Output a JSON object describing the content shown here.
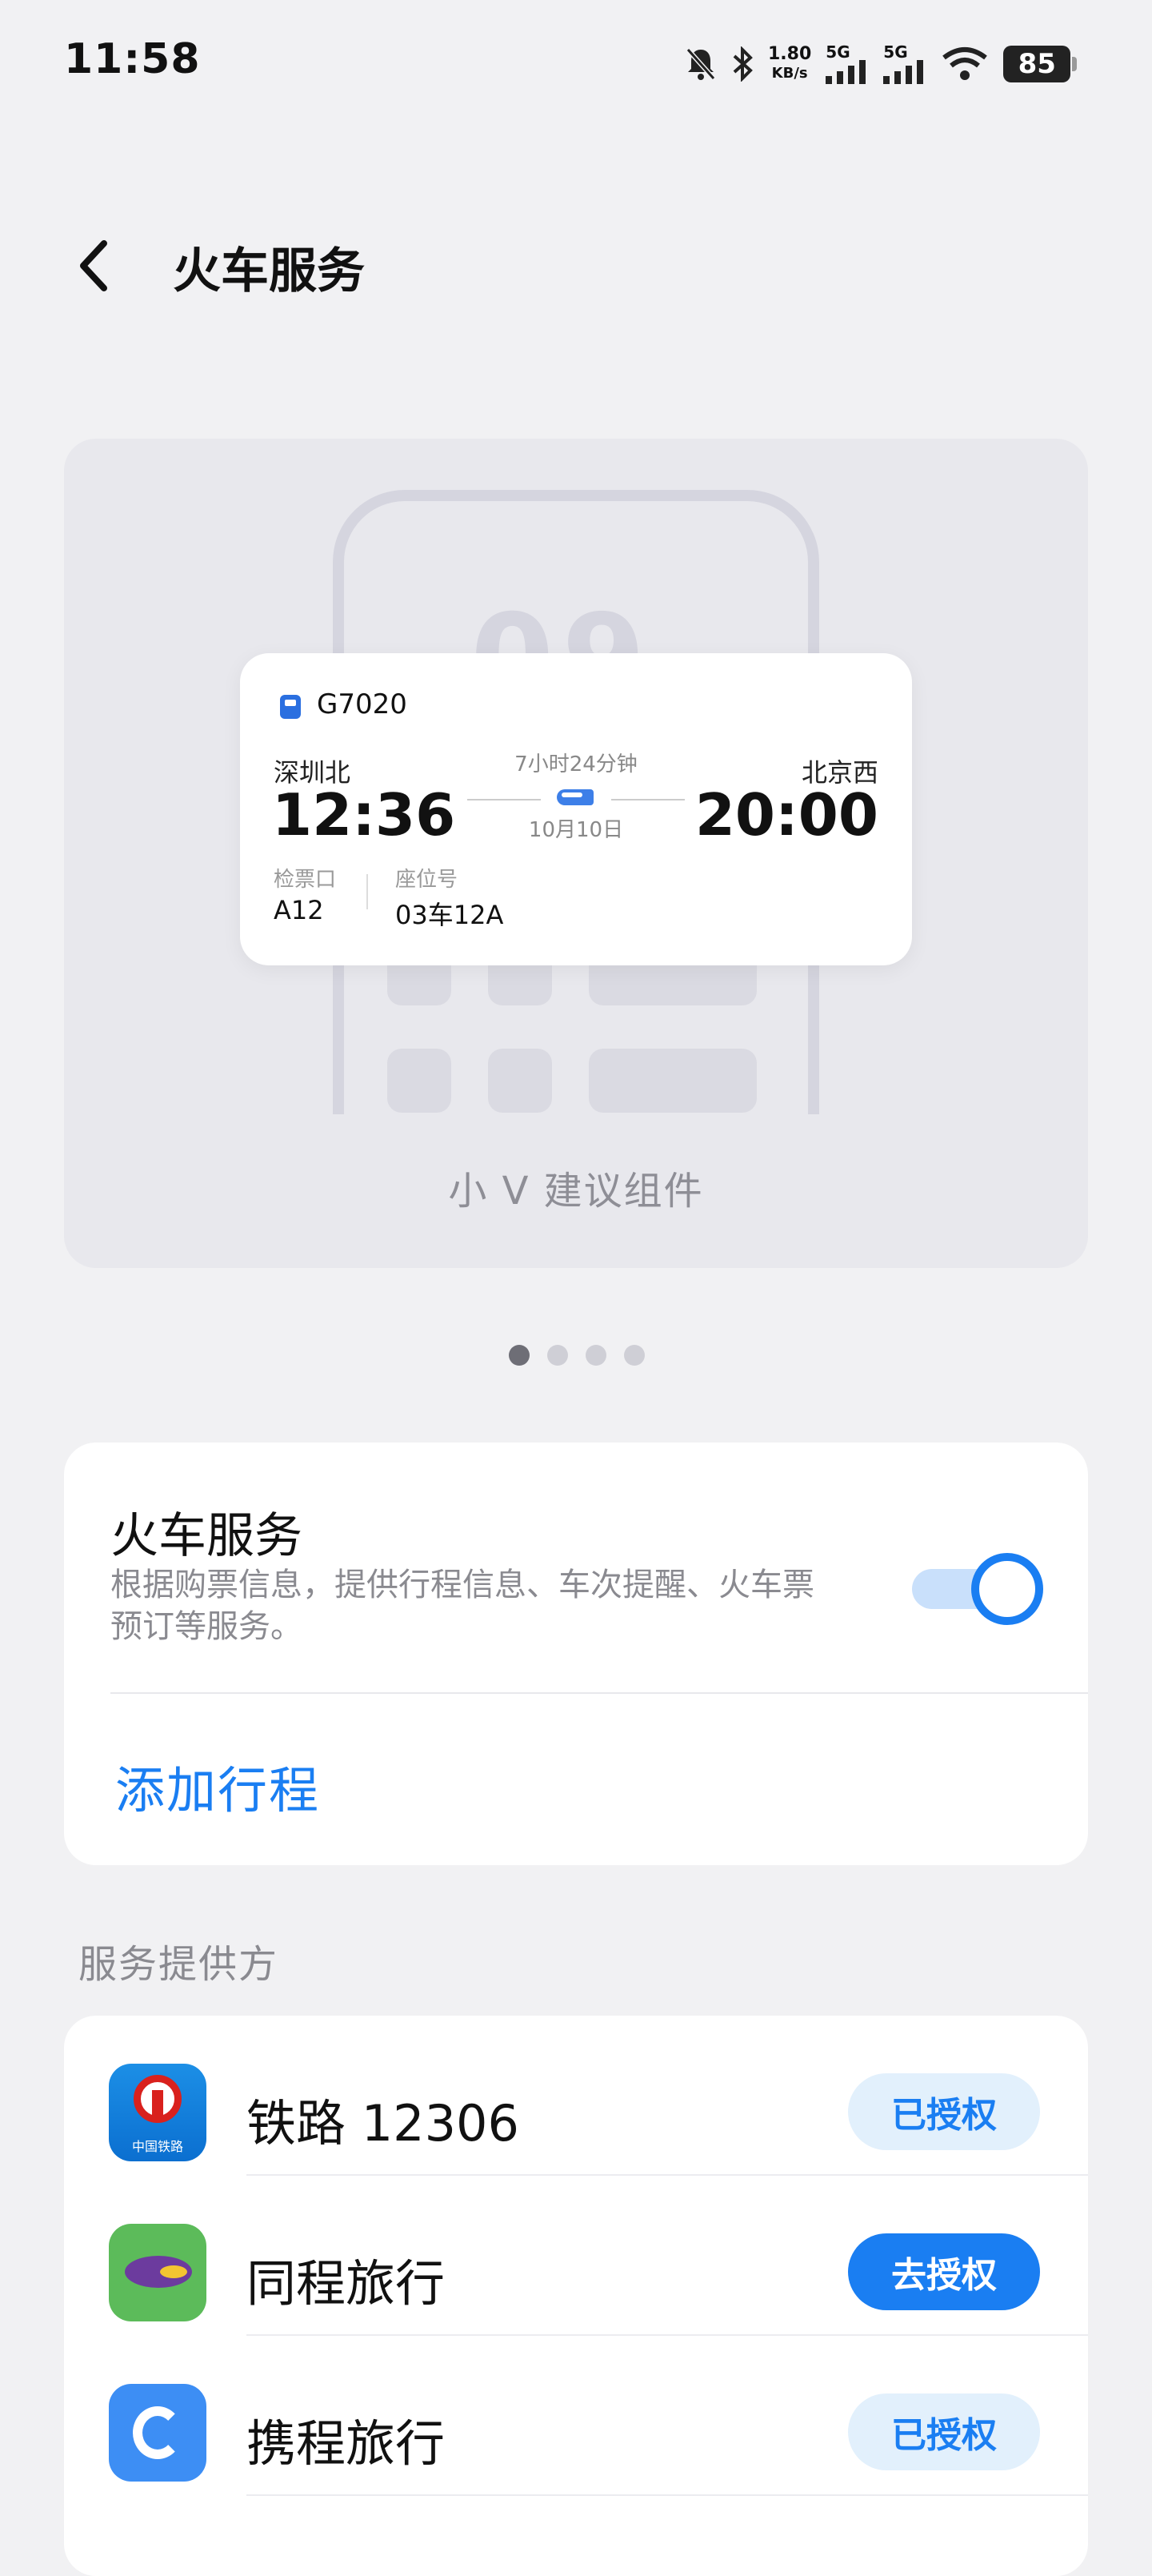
{
  "status_bar": {
    "time": "11:58",
    "net_speed_value": "1.80",
    "net_speed_unit": "KB/s",
    "sim1": "5G",
    "sim2": "5G",
    "battery": "85"
  },
  "header": {
    "title": "火车服务"
  },
  "preview": {
    "phone_digits": "09",
    "ticket": {
      "train_no": "G7020",
      "from_station": "深圳北",
      "depart_time": "12:36",
      "to_station": "北京西",
      "arrive_time": "20:00",
      "duration": "7小时24分钟",
      "date": "10月10日",
      "gate_label": "检票口",
      "gate_value": "A12",
      "seat_label": "座位号",
      "seat_value": "03车12A"
    },
    "caption": "小 V 建议组件",
    "pages": 4,
    "active_page": 1
  },
  "service": {
    "title": "火车服务",
    "description": "根据购票信息，提供行程信息、车次提醒、火车票预订等服务。",
    "enabled": true,
    "add_trip": "添加行程"
  },
  "providers": {
    "section_label": "服务提供方",
    "items": [
      {
        "name": "铁路 12306",
        "button": "已授权",
        "authorized": true,
        "logo_sub": "中国铁路"
      },
      {
        "name": "同程旅行",
        "button": "去授权",
        "authorized": false
      },
      {
        "name": "携程旅行",
        "button": "已授权",
        "authorized": true
      }
    ]
  },
  "colors": {
    "accent": "#1a7ef2",
    "background": "#f1f1f3"
  }
}
